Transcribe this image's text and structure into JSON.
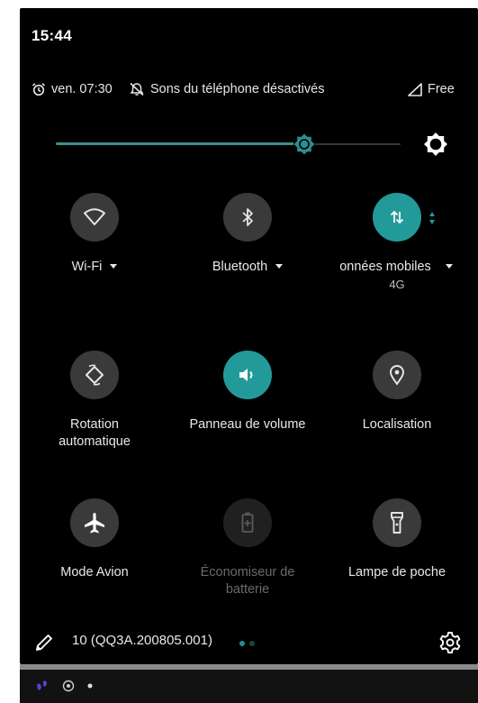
{
  "status_bar": {
    "time": "15:44"
  },
  "info_row": {
    "alarm_icon": "alarm-clock-icon",
    "alarm_time": "ven. 07:30",
    "dnd_icon": "notifications-off-icon",
    "sound_status": "Sons du téléphone désactivés",
    "signal_icon": "cell-signal-icon",
    "carrier": "Free"
  },
  "brightness": {
    "level_percent": 72,
    "auto_icon": "auto-brightness-icon"
  },
  "tiles": [
    {
      "label": "Wi-Fi",
      "sublabel": "",
      "icon": "wifi-icon",
      "state": "off",
      "has_dropdown": true
    },
    {
      "label": "Bluetooth",
      "sublabel": "",
      "icon": "bluetooth-icon",
      "state": "off",
      "has_dropdown": true
    },
    {
      "label": "onnées mobiles",
      "sublabel": "4G",
      "icon": "mobile-data-icon",
      "state": "on",
      "has_dropdown": true
    },
    {
      "label": "Rotation automatique",
      "label_line1": "Rotation",
      "label_line2": "automatique",
      "icon": "auto-rotate-icon",
      "state": "off"
    },
    {
      "label": "Panneau de volume",
      "icon": "volume-icon",
      "state": "on"
    },
    {
      "label": "Localisation",
      "icon": "location-icon",
      "state": "off"
    },
    {
      "label": "Mode Avion",
      "icon": "airplane-icon",
      "state": "off"
    },
    {
      "label": "Économiseur de batterie",
      "label_line1": "Économiseur de",
      "label_line2": "batterie",
      "icon": "battery-saver-icon",
      "state": "unavailable"
    },
    {
      "label": "Lampe de poche",
      "icon": "flashlight-icon",
      "state": "off"
    }
  ],
  "footer": {
    "edit_icon": "pencil-icon",
    "build": "10 (QQ3A.200805.001)",
    "page_count": 2,
    "current_page": 1,
    "settings_icon": "settings-icon"
  },
  "notification_bar": {
    "icons": [
      "app-notification-icon",
      "target-icon",
      "dot-icon"
    ]
  },
  "colors": {
    "accent": "#229a9a",
    "tile_off": "#3a3a3a",
    "background": "#000000"
  }
}
